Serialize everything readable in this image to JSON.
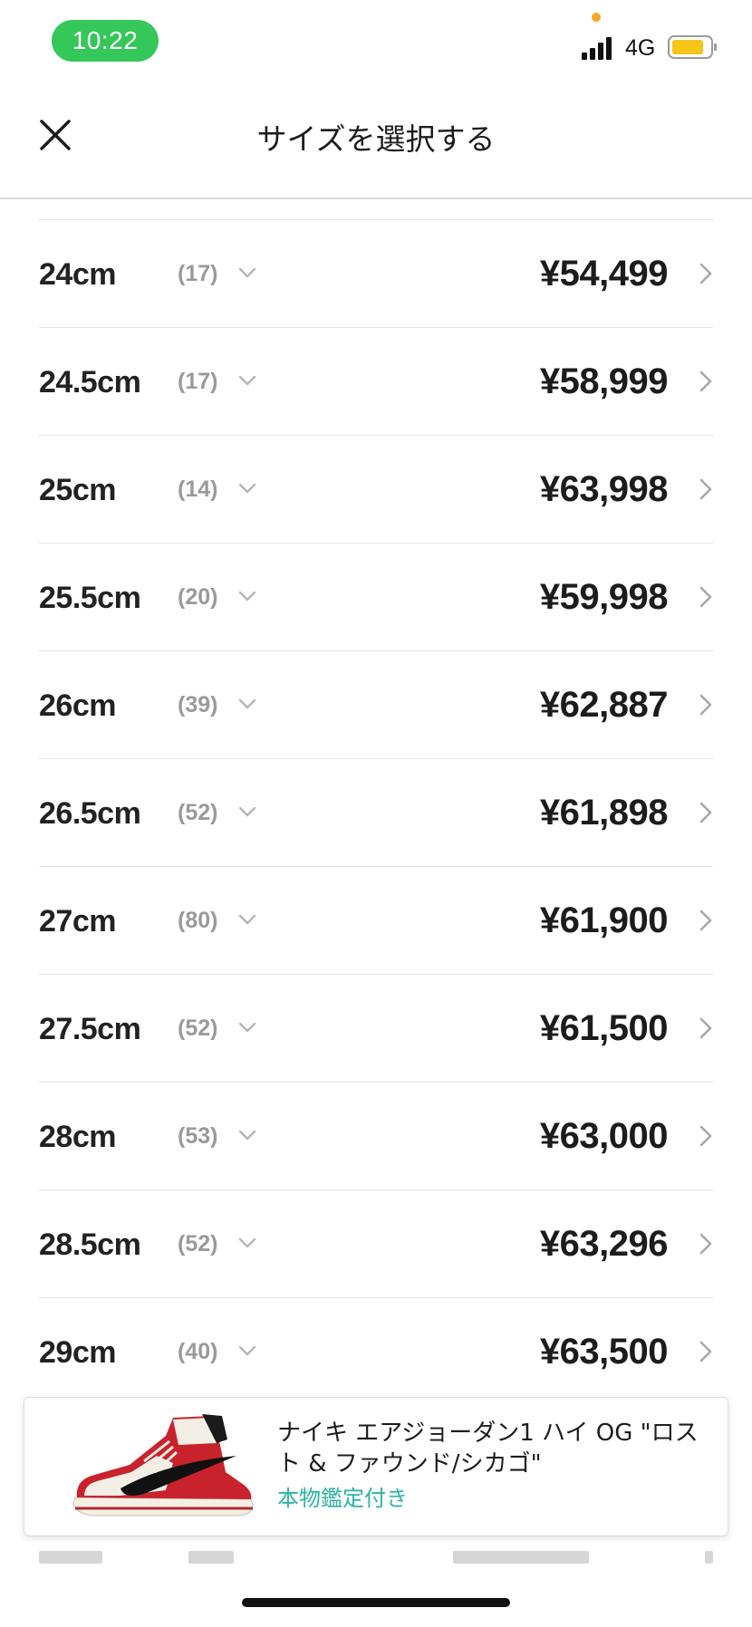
{
  "status_bar": {
    "time": "10:22",
    "network": "4G",
    "battery_color": "#f5c518",
    "icons": [
      "signal-icon",
      "battery-icon"
    ]
  },
  "header": {
    "title": "サイズを選択する",
    "close_icon": "close-icon"
  },
  "sizes": [
    {
      "size": "24cm",
      "count": "(17)",
      "price": "¥54,499"
    },
    {
      "size": "24.5cm",
      "count": "(17)",
      "price": "¥58,999"
    },
    {
      "size": "25cm",
      "count": "(14)",
      "price": "¥63,998"
    },
    {
      "size": "25.5cm",
      "count": "(20)",
      "price": "¥59,998"
    },
    {
      "size": "26cm",
      "count": "(39)",
      "price": "¥62,887"
    },
    {
      "size": "26.5cm",
      "count": "(52)",
      "price": "¥61,898"
    },
    {
      "size": "27cm",
      "count": "(80)",
      "price": "¥61,900"
    },
    {
      "size": "27.5cm",
      "count": "(52)",
      "price": "¥61,500"
    },
    {
      "size": "28cm",
      "count": "(53)",
      "price": "¥63,000"
    },
    {
      "size": "28.5cm",
      "count": "(52)",
      "price": "¥63,296"
    },
    {
      "size": "29cm",
      "count": "(40)",
      "price": "¥63,500"
    }
  ],
  "product": {
    "name": "ナイキ エアジョーダン1 ハイ OG \"ロスト & ファウンド/シカゴ\"",
    "badge": "本物鑑定付き",
    "badge_color": "#2bb3a4"
  },
  "colors": {
    "accent_green": "#35c759",
    "text_primary": "#1c1c1c",
    "text_muted": "#9a9a9a"
  }
}
